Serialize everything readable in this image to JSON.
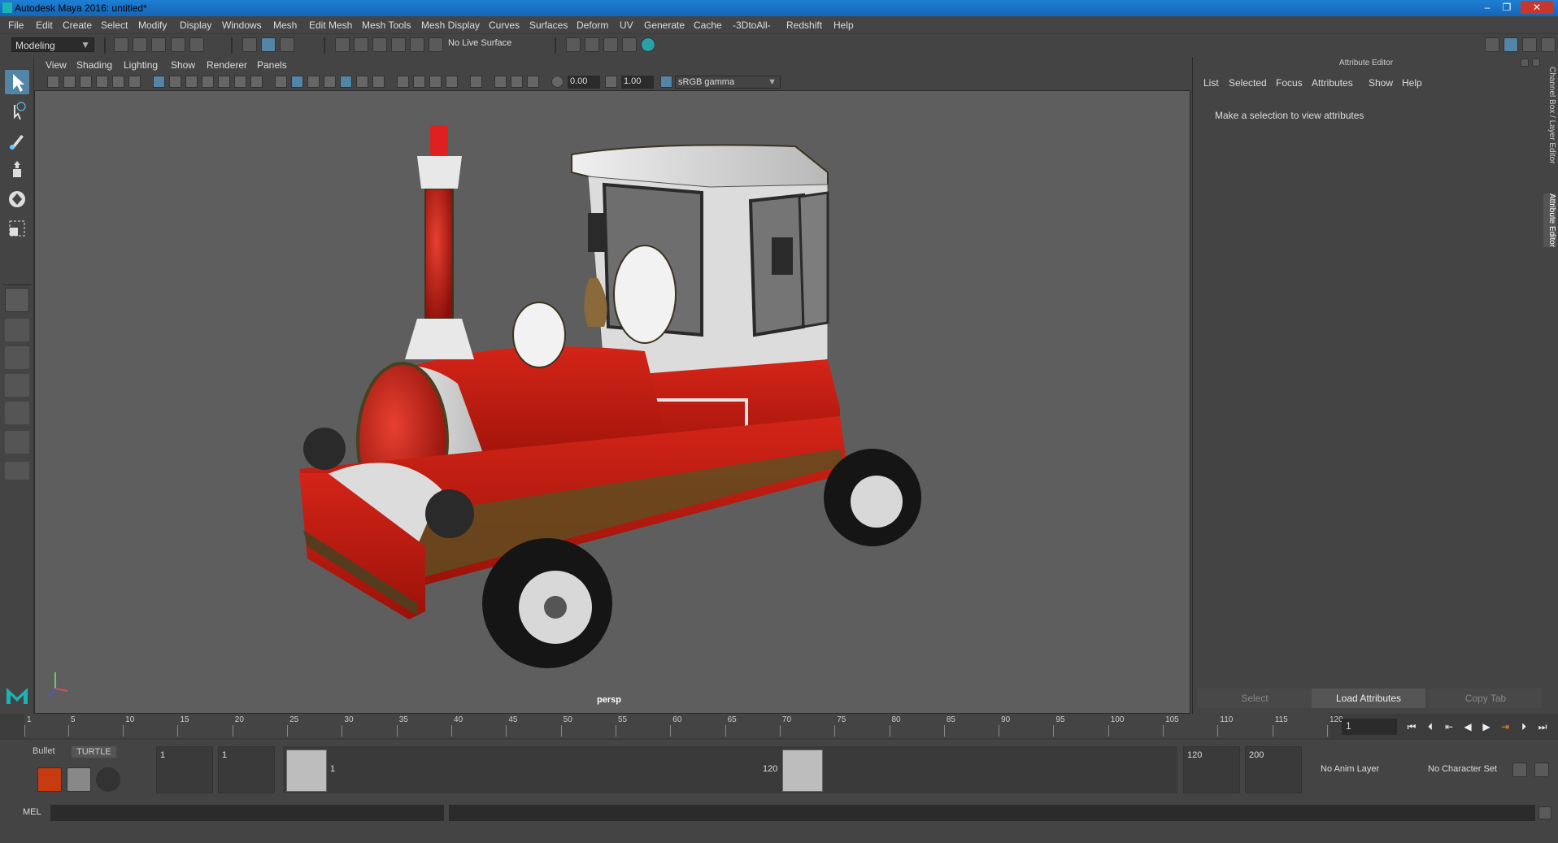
{
  "window": {
    "title": "Autodesk Maya 2016: untitled*",
    "controls": [
      "–",
      "❐",
      "✕"
    ]
  },
  "menubar": [
    "File",
    "Edit",
    "Create",
    "Select",
    "Modify",
    "Display",
    "Windows",
    "Mesh",
    "Edit Mesh",
    "Mesh Tools",
    "Mesh Display",
    "Curves",
    "Surfaces",
    "Deform",
    "UV",
    "Generate",
    "Cache",
    "-3DtoAll-",
    "Redshift",
    "Help"
  ],
  "statusline": {
    "mode": "Modeling",
    "live_surface": "No Live Surface"
  },
  "viewport": {
    "menus": [
      "View",
      "Shading",
      "Lighting",
      "Show",
      "Renderer",
      "Panels"
    ],
    "exposure": "0.00",
    "gamma": "1.00",
    "color_space": "sRGB gamma",
    "camera_label": "persp"
  },
  "attribute_editor": {
    "title": "Attribute Editor",
    "menus": [
      "List",
      "Selected",
      "Focus",
      "Attributes",
      "Show",
      "Help"
    ],
    "message": "Make a selection to view attributes",
    "buttons": [
      "Select",
      "Load Attributes",
      "Copy Tab"
    ],
    "side_tabs": [
      "Channel Box / Layer Editor",
      "Attribute Editor"
    ]
  },
  "timeline": {
    "ticks": [
      "1",
      "5",
      "10",
      "15",
      "20",
      "25",
      "30",
      "35",
      "40",
      "45",
      "50",
      "55",
      "60",
      "65",
      "70",
      "75",
      "80",
      "85",
      "90",
      "95",
      "100",
      "105",
      "110",
      "115",
      "120"
    ],
    "current_frame": "1"
  },
  "range": {
    "start": "1",
    "playback_start": "1",
    "slider_start": "1",
    "slider_end": "120",
    "playback_end": "120",
    "end": "200",
    "anim_layer": "No Anim Layer",
    "character_set": "No Character Set"
  },
  "shelf": {
    "tabs": [
      "Bullet",
      "TURTLE"
    ]
  },
  "command_line": {
    "label": "MEL"
  },
  "colors": {
    "accent": "#1e7fd2",
    "train_red": "#c81810",
    "viewport_bg": "#5e5e5e"
  }
}
